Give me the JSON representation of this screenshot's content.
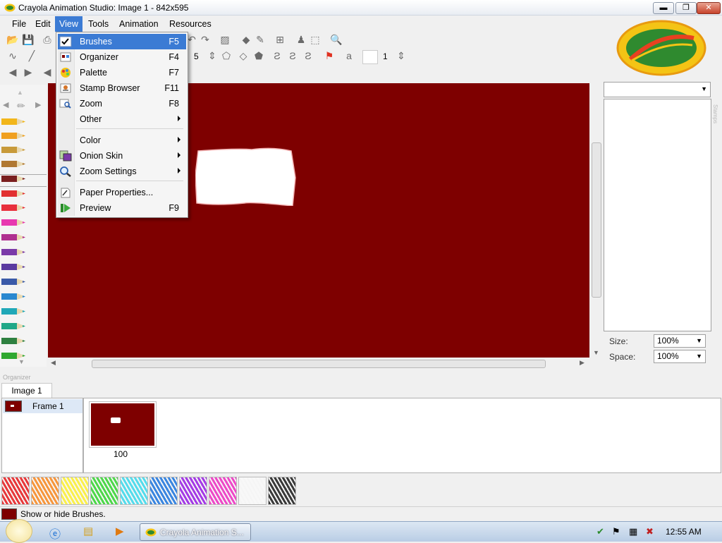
{
  "window": {
    "title": "Crayola Animation Studio: Image 1 - 842x595",
    "btn_minimize": "▬",
    "btn_maximize": "❐",
    "btn_close": "✕"
  },
  "menubar": {
    "items": [
      "File",
      "Edit",
      "View",
      "Tools",
      "Animation",
      "Resources"
    ]
  },
  "toolbar": {
    "brush_size": "5",
    "stamp_count": "1"
  },
  "view_menu": {
    "items": [
      {
        "label": "Brushes",
        "shortcut": "F5",
        "icon": "check-icon"
      },
      {
        "label": "Organizer",
        "shortcut": "F4",
        "icon": "organizer-icon"
      },
      {
        "label": "Palette",
        "shortcut": "F7",
        "icon": "palette-icon"
      },
      {
        "label": "Stamp Browser",
        "shortcut": "F11",
        "icon": "stamp-icon"
      },
      {
        "label": "Zoom",
        "shortcut": "F8",
        "icon": "zoom-icon"
      },
      {
        "label": "Other",
        "shortcut": "",
        "icon": "",
        "submenu": true
      },
      {
        "label": "Color",
        "shortcut": "",
        "icon": "",
        "submenu": true
      },
      {
        "label": "Onion Skin",
        "shortcut": "",
        "icon": "onion-skin-icon",
        "submenu": true
      },
      {
        "label": "Zoom Settings",
        "shortcut": "",
        "icon": "magnifier-icon",
        "submenu": true
      },
      {
        "label": "Paper Properties...",
        "shortcut": "",
        "icon": "paper-icon"
      },
      {
        "label": "Preview",
        "shortcut": "F9",
        "icon": "play-icon"
      }
    ]
  },
  "right_panel": {
    "size_label": "Size:",
    "size_value": "100%",
    "space_label": "Space:",
    "space_value": "100%",
    "stamps_caption": "Stamps"
  },
  "organizer": {
    "caption": "Organizer",
    "tab": "Image 1",
    "frame_label": "Frame 1",
    "frame_duration": "100"
  },
  "colors": {
    "canvas": "#7e0000",
    "swatches": [
      "#e8383a",
      "#f7963c",
      "#fbf04a",
      "#4ed84a",
      "#54dcec",
      "#3a86e0",
      "#a43ae6",
      "#ee48c8",
      "#f8f8f8",
      "#3a3a3a"
    ],
    "crayons": [
      "#f2b61a",
      "#f0a020",
      "#c89a3a",
      "#b07832",
      "#7a2020",
      "#e23030",
      "#e8303c",
      "#e838b0",
      "#b03090",
      "#7a3aa8",
      "#5a3aa0",
      "#3a5aa8",
      "#2a88d0",
      "#20a8b8",
      "#20a888",
      "#2e8040",
      "#30a830",
      "#7acc30"
    ]
  },
  "status": {
    "text": "Show or hide Brushes."
  },
  "taskbar": {
    "task_label": "Crayola Animation S...",
    "clock": "12:55 AM"
  }
}
